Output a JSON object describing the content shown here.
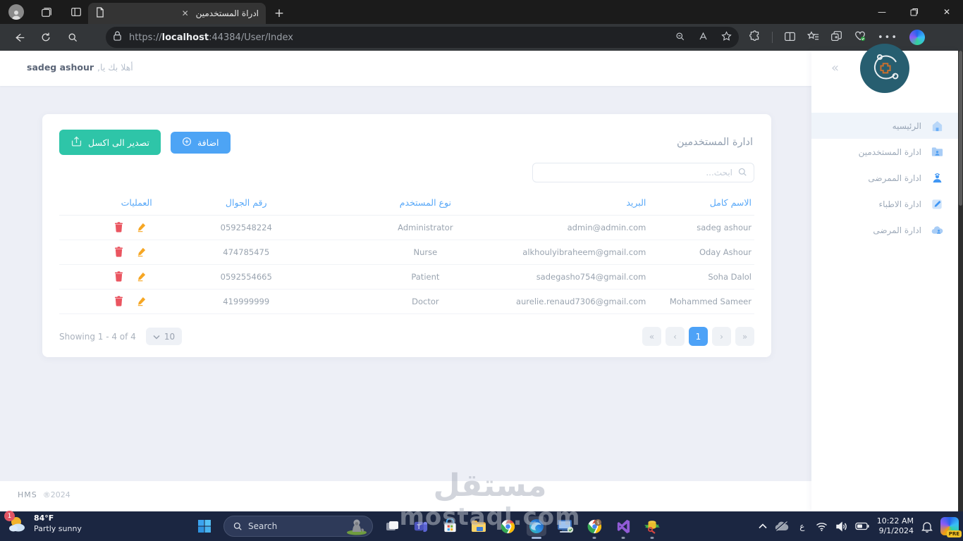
{
  "browser": {
    "tab_title": "ادراة المستخدمين",
    "url_scheme": "https://",
    "url_host": "localhost",
    "url_rest": ":44384/User/Index"
  },
  "header": {
    "welcome_prefix": "أهلا بك يا,",
    "username": "sadeg ashour"
  },
  "sidebar": {
    "items": [
      {
        "label": "الرئيسيه"
      },
      {
        "label": "ادارة المستخدمين"
      },
      {
        "label": "ادارة الممرضى"
      },
      {
        "label": "ادارة الاطباء"
      },
      {
        "label": "ادارة المرضى"
      }
    ]
  },
  "main": {
    "title": "ادارة المستخدمين",
    "export_label": "تصدير الى اكسل",
    "add_label": "اضافة",
    "search_placeholder": "ابحث...",
    "table_headers": {
      "name": "الاسم كامل",
      "email": "البريد",
      "type": "نوع المستخدم",
      "phone": "رقم الجوال",
      "actions": "العمليات"
    },
    "users": [
      {
        "name": "sadeg ashour",
        "email": "admin@admin.com",
        "type": "Administrator",
        "phone": "0592548224"
      },
      {
        "name": "Oday Ashour",
        "email": "alkhoulyibraheem@gmail.com",
        "type": "Nurse",
        "phone": "474785475"
      },
      {
        "name": "Soha Dalol",
        "email": "sadegasho754@gmail.com",
        "type": "Patient",
        "phone": "0592554665"
      },
      {
        "name": "Mohammed Sameer",
        "email": "aurelie.renaud7306@gmail.com",
        "type": "Doctor",
        "phone": "419999999"
      }
    ],
    "table_footer": {
      "showing": "Showing 1 - 4 of 4",
      "page_size": "10"
    },
    "pagination": {
      "first": "«",
      "prev": "‹",
      "page": "1",
      "next": "›",
      "last": "»"
    }
  },
  "footer": {
    "brand": "HMS",
    "year": "®2024"
  },
  "watermark": {
    "line1": "مستقل",
    "line2": "mostaql.com"
  },
  "taskbar": {
    "weather": {
      "badge": "1",
      "temp": "84°F",
      "condition": "Partly sunny"
    },
    "search_label": "Search",
    "tray": {
      "language": "ع",
      "time": "10:22 AM",
      "date": "9/1/2024"
    }
  },
  "colors": {
    "accent_blue": "#4da4f5",
    "accent_green": "#2ec5a8",
    "delete_red": "#ea5560",
    "edit_orange": "#f6a623",
    "logo_teal": "#275e70"
  }
}
